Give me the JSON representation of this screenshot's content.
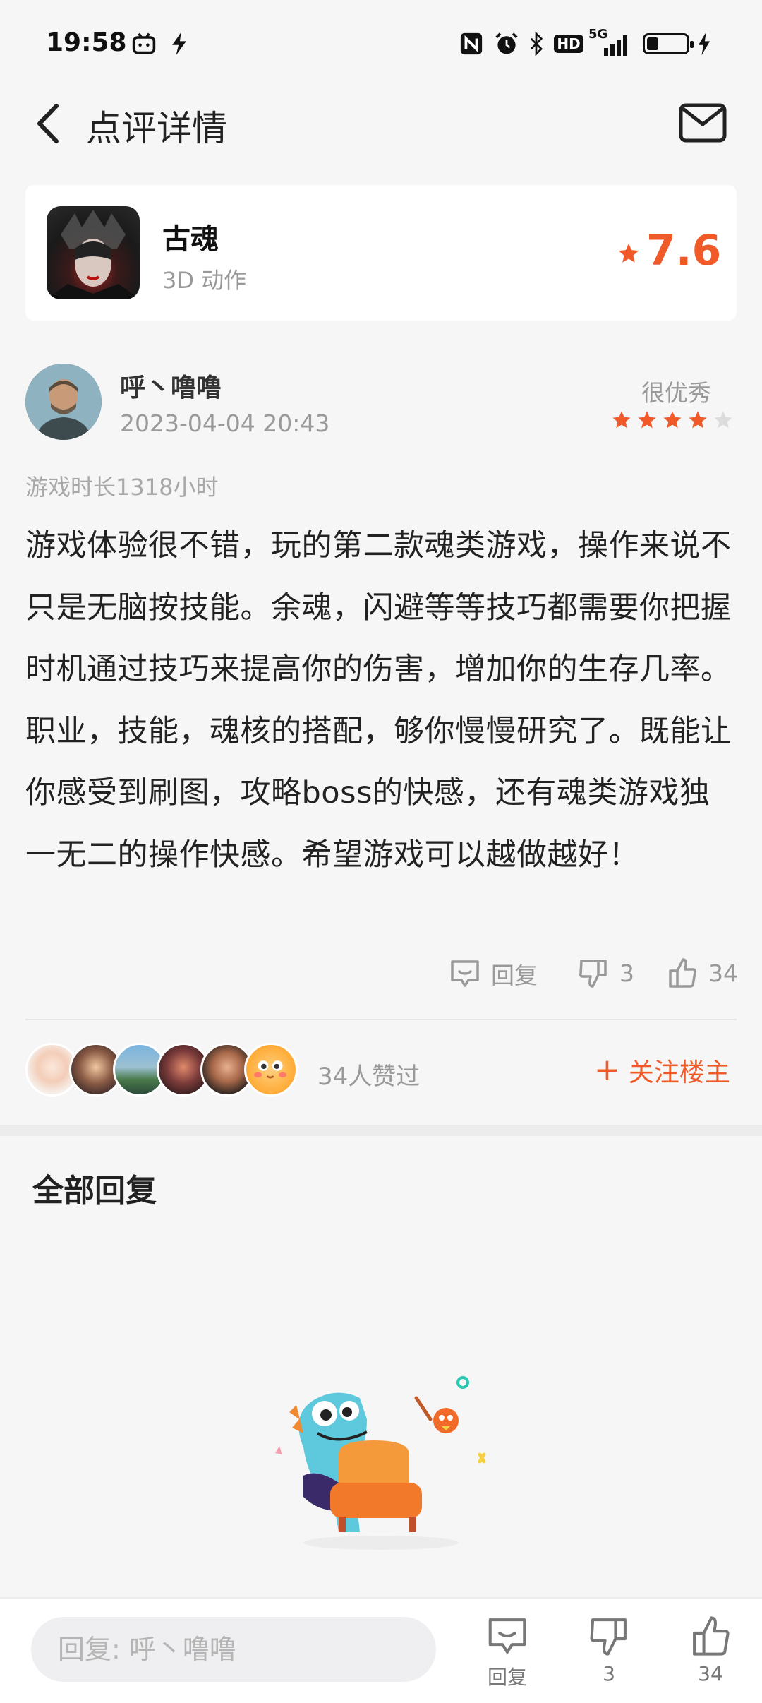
{
  "status_bar": {
    "time": "19:58",
    "icons": [
      "bilibili-icon",
      "bolt-app-icon",
      "nfc-icon",
      "alarm-icon",
      "bluetooth-icon",
      "hd-icon",
      "5g-signal-icon",
      "battery-icon",
      "charging-icon"
    ],
    "hd_label": "HD",
    "net_label": "5G"
  },
  "header": {
    "title": "点评详情",
    "back_icon": "chevron-left-icon",
    "mail_icon": "mail-icon"
  },
  "game": {
    "name": "古魂",
    "tags": "3D  动作",
    "score": "7.6",
    "accent_color": "#f05a28"
  },
  "review": {
    "author": "呼丶噜噜",
    "date": "2023-04-04  20:43",
    "rating_label": "很优秀",
    "stars": 4,
    "stars_total": 5,
    "play_time": "游戏时长1318小时",
    "content": "游戏体验很不错，玩的第二款魂类游戏，操作来说不只是无脑按技能。余魂，闪避等等技巧都需要你把握时机通过技巧来提高你的伤害，增加你的生存几率。职业，技能，魂核的搭配，够你慢慢研究了。既能让你感受到刷图，攻略boss的快感，还有魂类游戏独一无二的操作快感。希望游戏可以越做越好！"
  },
  "actions": {
    "reply_label": "回复",
    "dislike_count": "3",
    "like_count": "34"
  },
  "likers": {
    "count_text": "34人赞过",
    "follow_label": "关注楼主"
  },
  "replies_section": {
    "title": "全部回复"
  },
  "bottom_bar": {
    "input_placeholder": "回复: 呼丶噜噜",
    "reply_label": "回复",
    "dislike_count": "3",
    "like_count": "34"
  }
}
